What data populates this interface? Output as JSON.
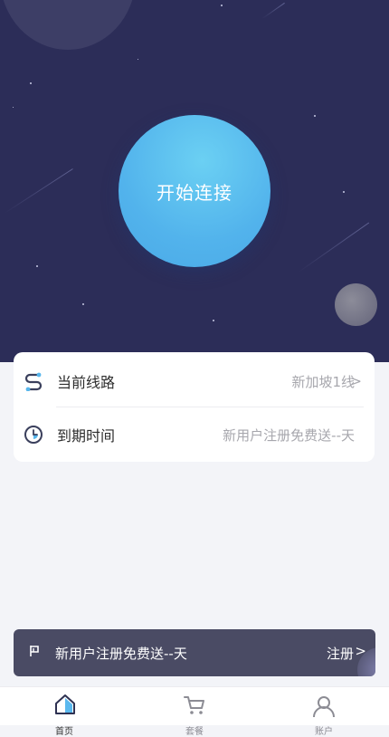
{
  "hero": {
    "connect_label": "开始连接"
  },
  "info": {
    "line_label": "当前线路",
    "line_value": "新加坡1线",
    "line_chevron": ">",
    "expire_label": "到期时间",
    "expire_value": "新用户注册免费送--天"
  },
  "promo": {
    "text": "新用户注册免费送--天",
    "action": "注册",
    "action_arrow": ">"
  },
  "tabs": [
    {
      "label": "首页",
      "icon": "home-icon",
      "active": true
    },
    {
      "label": "套餐",
      "icon": "cart-icon",
      "active": false
    },
    {
      "label": "账户",
      "icon": "user-icon",
      "active": false
    }
  ],
  "colors": {
    "hero_bg": "#2c2d58",
    "accent": "#52b3ec",
    "promo_bg": "#4a4b64",
    "page_bg": "#f3f4f8"
  }
}
